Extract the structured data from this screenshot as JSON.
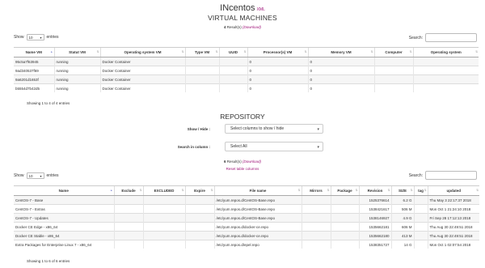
{
  "header": {
    "host": "INcentos",
    "xml_link": "XML"
  },
  "vm": {
    "heading": "VIRTUAL MACHINES",
    "results_count": "4",
    "results_text": " Result(s)",
    "download": "(Download)",
    "show_label": "Show",
    "show_value": "10",
    "entries_label": "entries",
    "search_label": "Search:",
    "columns": [
      "Name VM",
      "Statut VM",
      "Operating system VM",
      "Type VM",
      "UUID",
      "Processor(s) VM",
      "Memory VM",
      "Computer",
      "Operating system"
    ],
    "rows": [
      [
        "95c5a7f63945",
        "running",
        "Docker Container",
        "",
        "",
        "0",
        "0",
        "",
        ""
      ],
      [
        "9ad340537f69",
        "running",
        "Docker Container",
        "",
        "",
        "0",
        "0",
        "",
        ""
      ],
      [
        "9a6201d1653f",
        "running",
        "Docker Container",
        "",
        "",
        "0",
        "0",
        "",
        ""
      ],
      [
        "b5554d7b42d5",
        "running",
        "Docker Container",
        "",
        "",
        "0",
        "0",
        "",
        ""
      ]
    ],
    "info": "Showing 1 to 4 of 4 entries"
  },
  "repo": {
    "heading": "REPOSITORY",
    "show_hide_label": "Show / Hide :",
    "show_hide_value": "Select columns to show / hide",
    "search_column_label": "Search in column :",
    "search_column_value": "Select All",
    "results_count": "6",
    "results_text": " Result(s)",
    "download": "(Download)",
    "reset": "Reset table columns",
    "show_label": "Show",
    "show_value": "10",
    "entries_label": "entries",
    "search_label": "Search:",
    "columns": [
      "Name",
      "Exclude",
      "EXCLUDED",
      "Expire",
      "File name",
      "Mirrors",
      "Package",
      "Revision",
      "SIZE",
      "tag",
      "updated"
    ],
    "rows": [
      [
        "CentOS-7 - Base",
        "",
        "",
        "",
        "/etc/yum.repos.d/CentOS-Base.repo",
        "",
        "",
        "1525376614",
        "6.2 G",
        "",
        "Thu May 3 22:17:37 2018"
      ],
      [
        "CentOS-7 - Extras",
        "",
        "",
        "",
        "/etc/yum.repos.d/CentOS-Base.repo",
        "",
        "",
        "1538421617",
        "506 M",
        "",
        "Mon Oct 1 21:24:10 2018"
      ],
      [
        "CentOS-7 - Updates",
        "",
        "",
        "",
        "/etc/yum.repos.d/CentOS-Base.repo",
        "",
        "",
        "1538146927",
        "4.9 G",
        "",
        "Fri Sep 28 17:12:13 2018"
      ],
      [
        "Docker CE Edge - x86_64",
        "",
        "",
        "",
        "/etc/yum.repos.d/docker-ce.repo",
        "",
        "",
        "1535662181",
        "606 M",
        "",
        "Thu Aug 30 22:49:51 2018"
      ],
      [
        "Docker CE Stable - x86_64",
        "",
        "",
        "",
        "/etc/yum.repos.d/docker-ce.repo",
        "",
        "",
        "1535662180",
        "413 M",
        "",
        "Thu Aug 30 22:49:51 2018"
      ],
      [
        "Extra Packages for Enterprise Linux 7 - x86_64",
        "",
        "",
        "",
        "/etc/yum.repos.d/epel.repo",
        "",
        "",
        "1538351727",
        "14 G",
        "",
        "Mon Oct 1 02:07:54 2018"
      ]
    ],
    "info": "Showing 1 to 6 of 6 entries"
  }
}
